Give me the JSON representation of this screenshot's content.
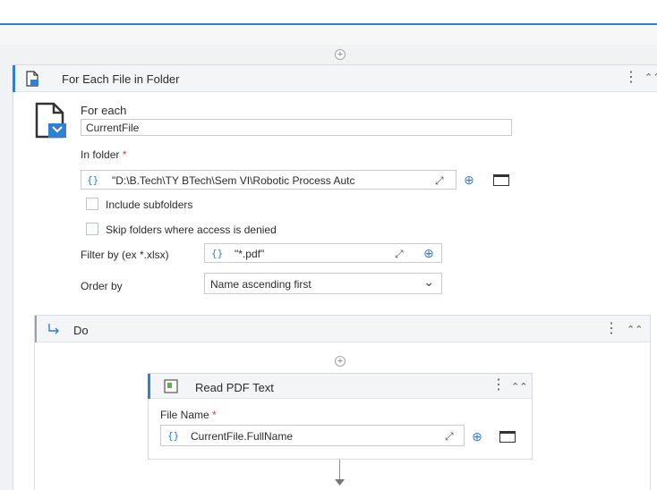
{
  "top_add_label": "+",
  "for_each_activity": {
    "title": "For Each File in Folder",
    "for_each_label": "For each",
    "for_each_value": "CurrentFile",
    "in_folder_label": "In folder",
    "required_marker": "*",
    "in_folder_value": "\"D:\\B.Tech\\TY BTech\\Sem VI\\Robotic Process Autc",
    "include_subfolders_label": "Include subfolders",
    "skip_folders_label": "Skip folders where access is denied",
    "filter_label": "Filter by (ex *.xlsx)",
    "filter_value": "\"*.pdf\"",
    "order_by_label": "Order by",
    "order_by_value": "Name ascending first"
  },
  "do_block": {
    "title": "Do",
    "add_label": "+"
  },
  "read_pdf_activity": {
    "title": "Read PDF Text",
    "file_name_label": "File Name",
    "required_marker": "*",
    "file_name_value": "CurrentFile.FullName"
  },
  "icons": {
    "braces": "{}",
    "expand": "⤢",
    "plus": "⊕",
    "kebab": "⋮",
    "collapse": "⌃⌃",
    "chevron_down": "⌄"
  },
  "colors": {
    "accent": "#2f7fd3",
    "background": "#f1f2f3"
  }
}
